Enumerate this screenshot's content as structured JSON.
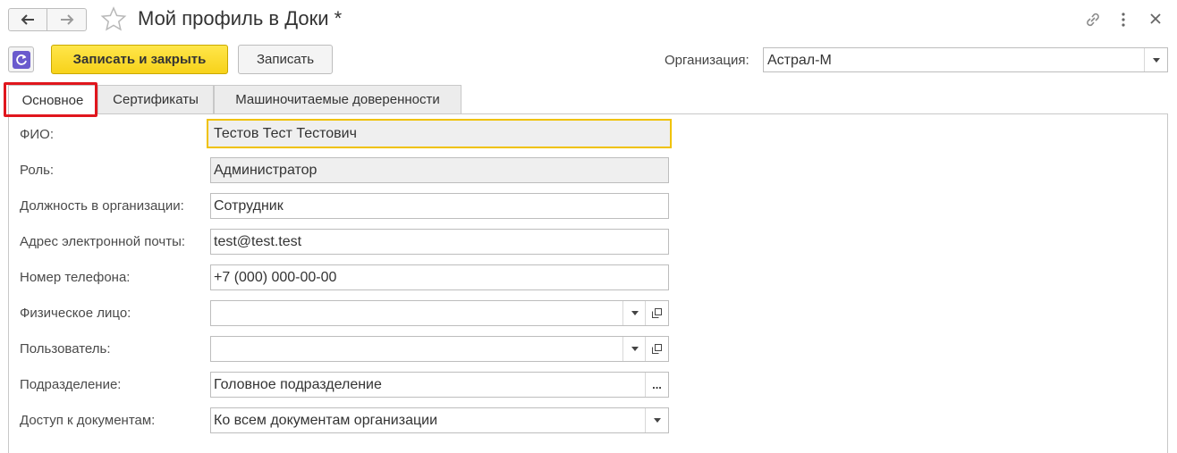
{
  "window": {
    "title": "Мой профиль в Доки *",
    "icons": [
      "arrow-left-icon",
      "arrow-right-icon",
      "star-icon",
      "link-icon",
      "more-vertical-icon",
      "close-icon"
    ]
  },
  "toolbar": {
    "save_close_label": "Записать и закрыть",
    "save_label": "Записать",
    "organization_label": "Организация:",
    "organization_value": "Астрал-М"
  },
  "tabs": [
    {
      "label": "Основное",
      "active": true
    },
    {
      "label": "Сертификаты",
      "active": false
    },
    {
      "label": "Машиночитаемые доверенности",
      "active": false
    }
  ],
  "form": {
    "fio": {
      "label": "ФИО:",
      "value": "Тестов Тест Тестович"
    },
    "role": {
      "label": "Роль:",
      "value": "Администратор"
    },
    "position": {
      "label": "Должность в организации:",
      "value": "Сотрудник"
    },
    "email": {
      "label": "Адрес электронной почты:",
      "value": "test@test.test"
    },
    "phone": {
      "label": "Номер телефона:",
      "value": "+7 (000) 000-00-00"
    },
    "person": {
      "label": "Физическое лицо:",
      "value": ""
    },
    "user": {
      "label": "Пользователь:",
      "value": ""
    },
    "department": {
      "label": "Подразделение:",
      "value": "Головное подразделение",
      "button": "..."
    },
    "access": {
      "label": "Доступ к документам:",
      "value": "Ко всем документам организации"
    }
  },
  "colors": {
    "primary_button": "#f7d21a",
    "focus_border": "#f0c200",
    "highlight_box": "#e0161d",
    "refresh_icon": "#6a5acd"
  }
}
